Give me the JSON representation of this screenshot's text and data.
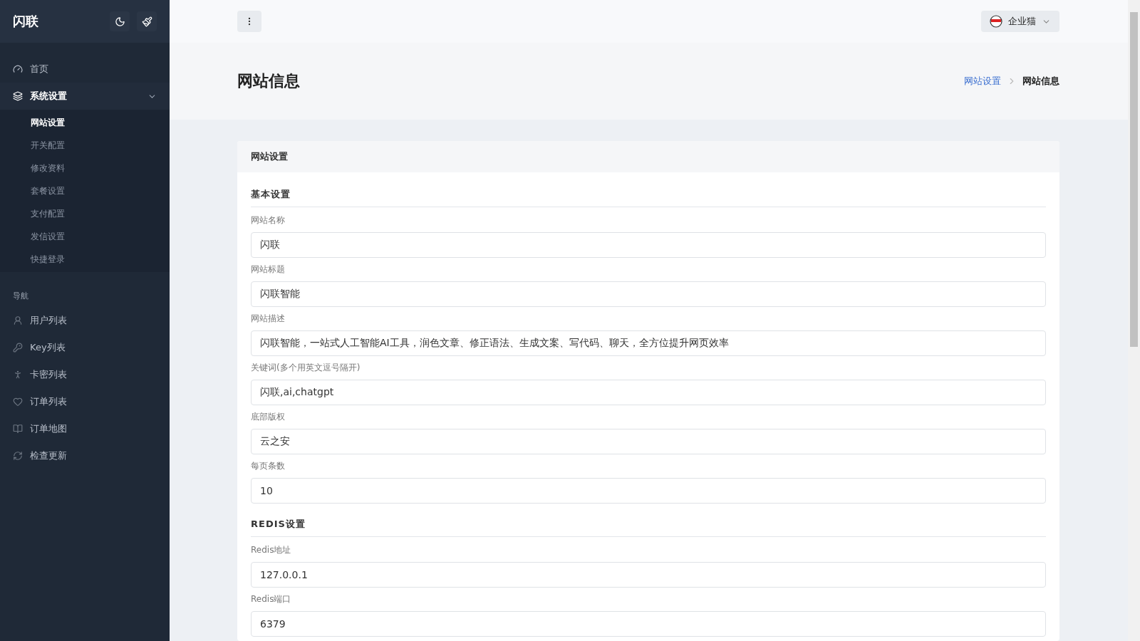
{
  "sidebar": {
    "brand": "闪联",
    "menu": [
      {
        "label": "首页",
        "selected": false
      },
      {
        "label": "系统设置",
        "selected": true,
        "expanded": true,
        "children": [
          {
            "label": "网站设置",
            "selected": true
          },
          {
            "label": "开关配置",
            "selected": false
          },
          {
            "label": "修改资料",
            "selected": false
          },
          {
            "label": "套餐设置",
            "selected": false
          },
          {
            "label": "支付配置",
            "selected": false
          },
          {
            "label": "发信设置",
            "selected": false
          },
          {
            "label": "快捷登录",
            "selected": false
          }
        ]
      }
    ],
    "nav_heading": "导航",
    "nav": [
      {
        "label": "用户列表",
        "selected": false
      },
      {
        "label": "Key列表",
        "selected": false
      },
      {
        "label": "卡密列表",
        "selected": false
      },
      {
        "label": "订单列表",
        "selected": false
      },
      {
        "label": "订单地图",
        "selected": false
      },
      {
        "label": "检查更新",
        "selected": false
      }
    ]
  },
  "topbar": {
    "user": "企业猫"
  },
  "page": {
    "title": "网站信息",
    "breadcrumb": [
      {
        "label": "网站设置",
        "kind": "link"
      },
      {
        "label": "网站信息",
        "kind": "current"
      }
    ]
  },
  "card": {
    "title": "网站设置",
    "sections": [
      {
        "title": "基本设置",
        "fields": [
          {
            "label": "网站名称",
            "value": "闪联"
          },
          {
            "label": "网站标题",
            "value": "闪联智能"
          },
          {
            "label": "网站描述",
            "value": "闪联智能，一站式人工智能AI工具，润色文章、修正语法、生成文案、写代码、聊天，全方位提升网页效率"
          },
          {
            "label": "关键词(多个用英文逗号隔开)",
            "value": "闪联,ai,chatgpt"
          },
          {
            "label": "底部版权",
            "value": "云之安"
          },
          {
            "label": "每页条数",
            "value": "10"
          }
        ]
      },
      {
        "title": "REDIS设置",
        "fields": [
          {
            "label": "Redis地址",
            "value": "127.0.0.1"
          },
          {
            "label": "Redis端口",
            "value": "6379"
          }
        ]
      }
    ]
  }
}
